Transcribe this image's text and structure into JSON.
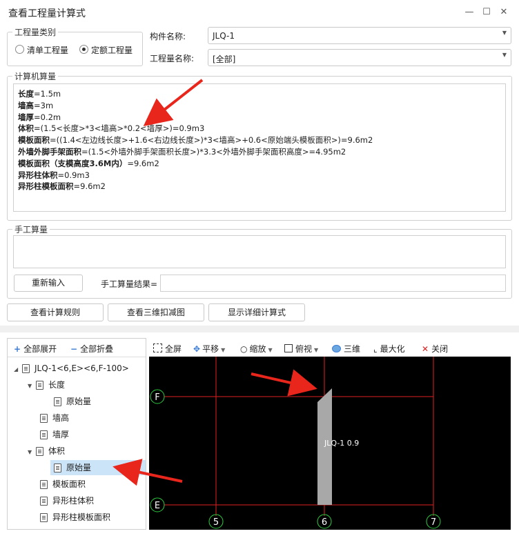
{
  "window": {
    "title": "查看工程量计算式",
    "minimize": "—",
    "maximize": "☐",
    "close": "✕"
  },
  "quantity_type": {
    "legend": "工程量类别",
    "options": [
      {
        "label": "清单工程量",
        "selected": false
      },
      {
        "label": "定额工程量",
        "selected": true
      }
    ]
  },
  "component": {
    "label": "构件名称:",
    "value": "JLQ-1"
  },
  "quantity_name": {
    "label": "工程量名称:",
    "value": "[全部]"
  },
  "computer_calc": {
    "legend": "计算机算量",
    "lines": [
      {
        "name": "长度",
        "expr": "=1.5m"
      },
      {
        "name": "墙高",
        "expr": "=3m"
      },
      {
        "name": "墙厚",
        "expr": "=0.2m"
      },
      {
        "name": "体积",
        "expr": "=(1.5<长度>*3<墙高>*0.2<墙厚>)=0.9m3"
      },
      {
        "name": "模板面积",
        "expr": "=((1.4<左边线长度>+1.6<右边线长度>)*3<墙高>+0.6<原始端头模板面积>)=9.6m2"
      },
      {
        "name": "外墙外脚手架面积",
        "expr": "=(1.5<外墙外脚手架面积长度>)*3.3<外墙外脚手架面积高度>=4.95m2"
      },
      {
        "name": "模板面积（支模高度3.6M内）",
        "expr": "=9.6m2"
      },
      {
        "name": "异形柱体积",
        "expr": "=0.9m3"
      },
      {
        "name": "异形柱模板面积",
        "expr": "=9.6m2"
      }
    ]
  },
  "manual_calc": {
    "legend": "手工算量",
    "reenter_button": "重新输入",
    "result_label": "手工算量结果=",
    "result_value": ""
  },
  "actions": {
    "view_rules": "查看计算规则",
    "view_3d": "查看三维扣减图",
    "show_detail": "显示详细计算式"
  },
  "tree_toolbar": {
    "expand_all": "全部展开",
    "collapse_all": "全部折叠"
  },
  "tree": {
    "root": "JLQ-1<6,E><6,F-100>",
    "length": "长度",
    "length_raw": "原始量",
    "wall_height": "墙高",
    "wall_thickness": "墙厚",
    "volume": "体积",
    "volume_raw": "原始量",
    "formwork_area": "模板面积",
    "special_col_volume": "异形柱体积",
    "special_col_formwork": "异形柱模板面积"
  },
  "viewer_toolbar": {
    "fullscreen": "全屏",
    "pan": "平移",
    "zoom": "缩放",
    "view": "俯视",
    "three_d": "三维",
    "maximize": "最大化",
    "close": "关闭"
  },
  "drawing": {
    "axes_vertical": [
      "5",
      "6",
      "7"
    ],
    "axes_horizontal": [
      "F",
      "E"
    ],
    "element_label": "JLQ-1 0.9",
    "grid_color": "#e02020",
    "bubble_color": "#2ecc40"
  }
}
